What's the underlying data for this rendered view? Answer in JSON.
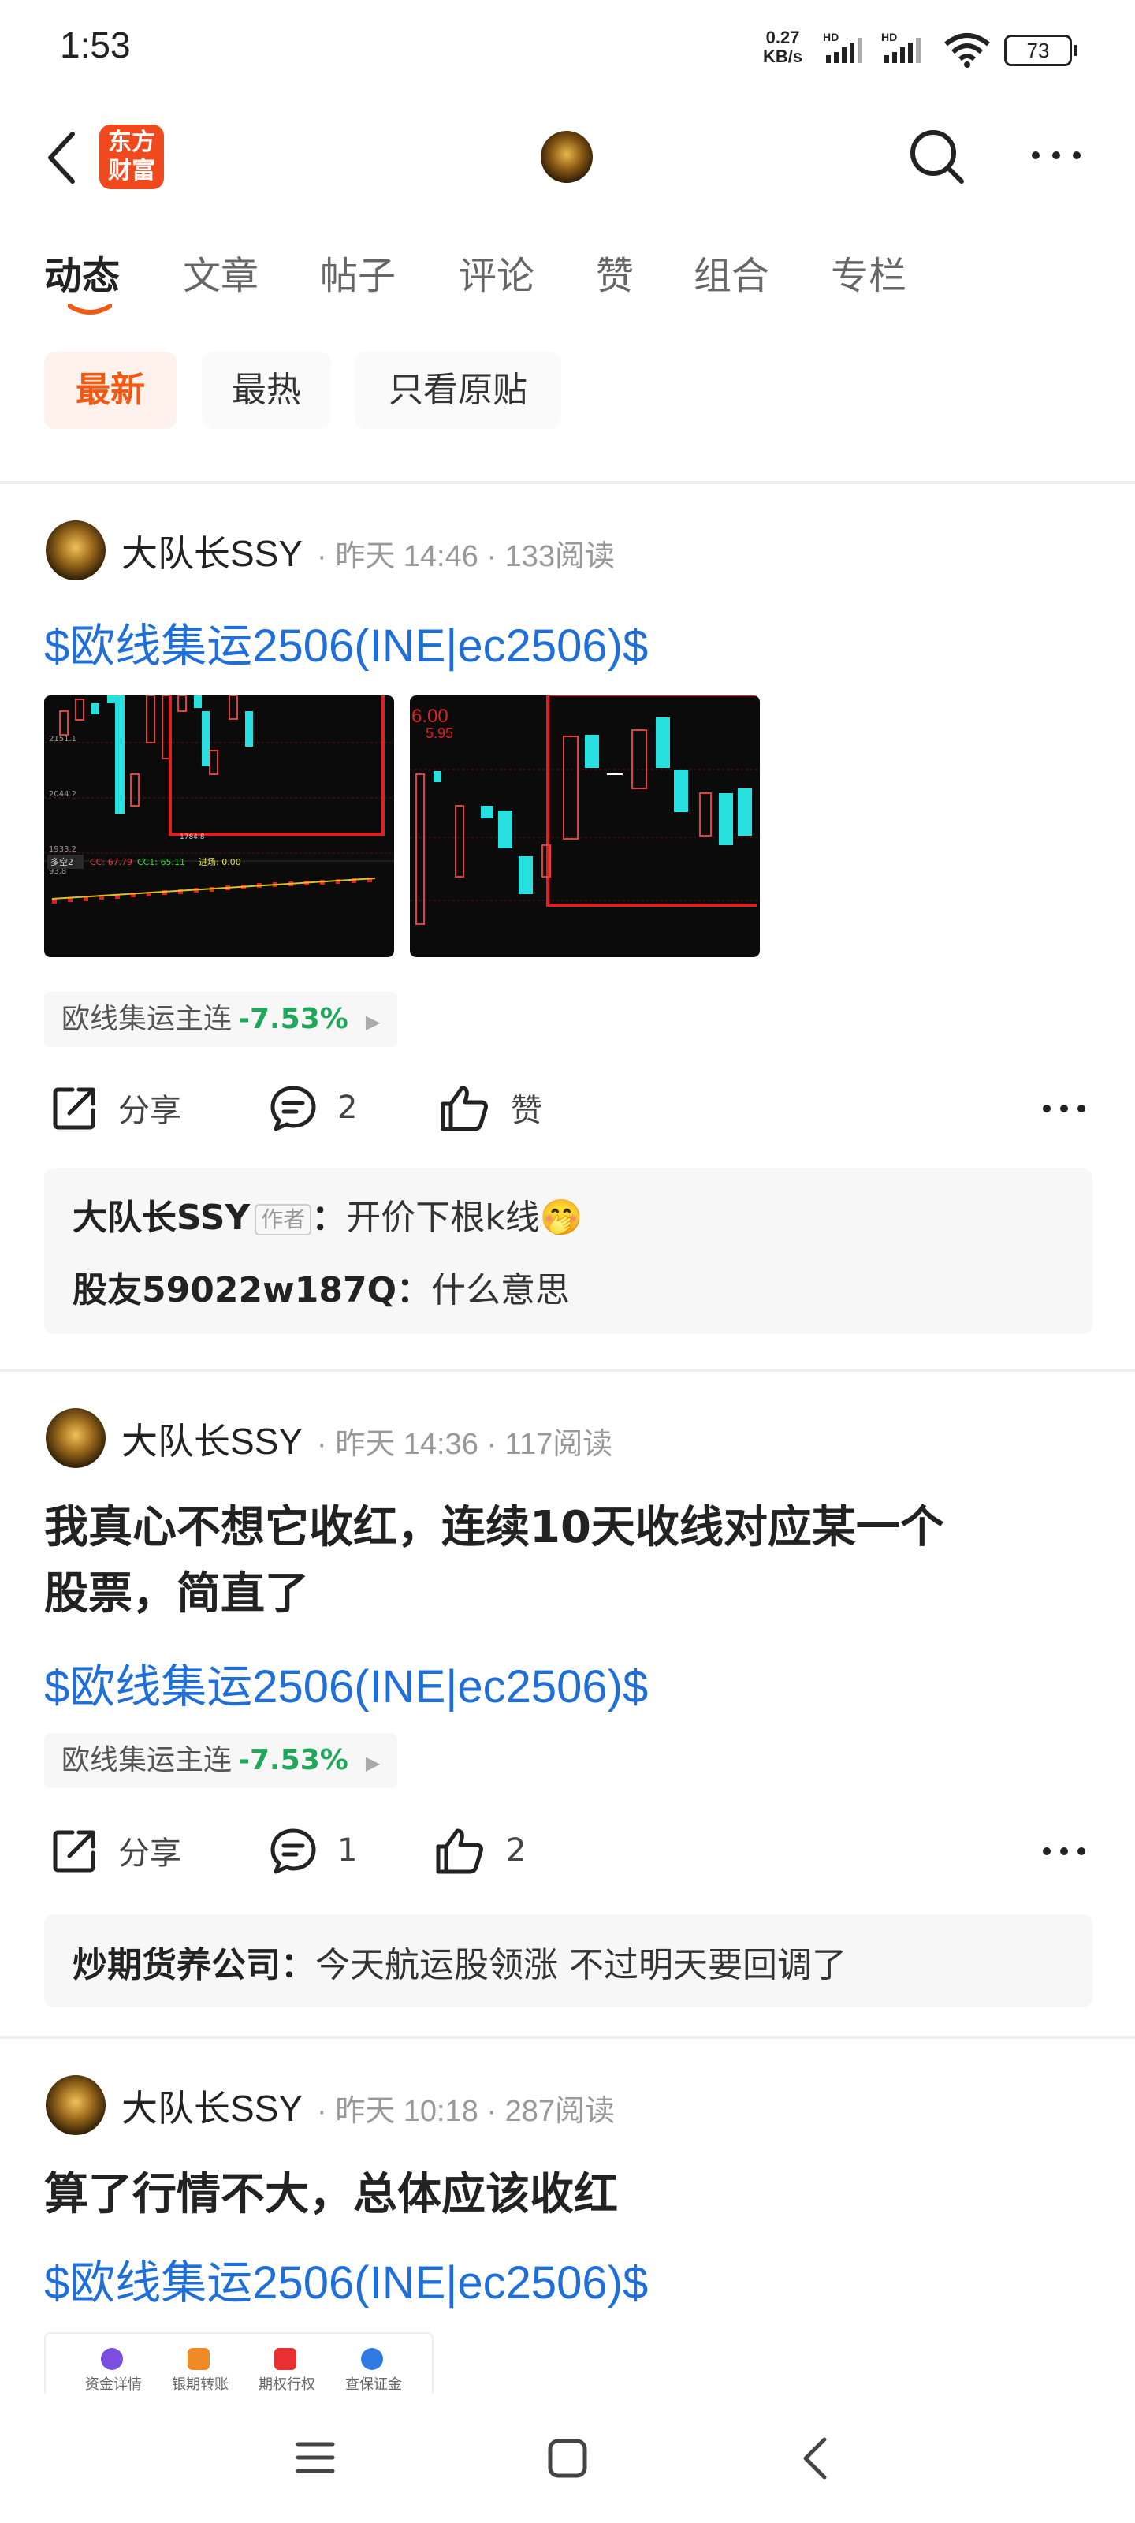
{
  "status_bar": {
    "time": "1:53",
    "net_speed_value": "0.27",
    "net_speed_unit": "KB/s",
    "battery": "73"
  },
  "header": {
    "logo_line1": "东方",
    "logo_line2": "财富"
  },
  "tabs": [
    {
      "label": "动态"
    },
    {
      "label": "文章"
    },
    {
      "label": "帖子"
    },
    {
      "label": "评论"
    },
    {
      "label": "赞"
    },
    {
      "label": "组合"
    },
    {
      "label": "专栏"
    }
  ],
  "filters": [
    {
      "label": "最新"
    },
    {
      "label": "最热"
    },
    {
      "label": "只看原贴"
    }
  ],
  "colors": {
    "accent": "#f05a14",
    "link": "#1e6fd9",
    "down": "#1fa85a"
  },
  "posts": [
    {
      "author": "大队长SSY",
      "meta": "· 昨天 14:46 · 133阅读",
      "link": "$欧线集运2506(INE|ec2506)$",
      "quote_name": "欧线集运主连",
      "quote_pct": "-7.53%",
      "share_label": "分享",
      "comment_count": "2",
      "like_label": "赞",
      "comments": [
        {
          "name": "大队长SSY",
          "tag": "作者",
          "text": "开价下根k线🤭"
        },
        {
          "name": "股友59022w187Q",
          "tag": "",
          "text": "什么意思"
        }
      ],
      "chart1_labels": [
        "2151.1",
        "2044.2",
        "1933.2",
        "1784.8",
        "93.8",
        "多空2",
        "CC: 67.79",
        "CC1: 65.11",
        "进场: 0.00"
      ],
      "chart2_labels": [
        "6.00",
        "5.95"
      ]
    },
    {
      "author": "大队长SSY",
      "meta": "· 昨天 14:36 · 117阅读",
      "title_line1": "我真心不想它收红，连续10天收线对应某一个",
      "title_line2": "股票，简直了",
      "link": "$欧线集运2506(INE|ec2506)$",
      "quote_name": "欧线集运主连",
      "quote_pct": "-7.53%",
      "share_label": "分享",
      "comment_count": "1",
      "like_count": "2",
      "comments": [
        {
          "name": "炒期货养公司",
          "text": "今天航运股领涨 不过明天要回调了"
        }
      ]
    },
    {
      "author": "大队长SSY",
      "meta": "· 昨天 10:18 · 287阅读",
      "title_line1": "算了行情不大，总体应该收红",
      "link": "$欧线集运2506(INE|ec2506)$",
      "mini_items": [
        "资金详情",
        "银期转账",
        "期权行权",
        "查保证金"
      ]
    }
  ]
}
